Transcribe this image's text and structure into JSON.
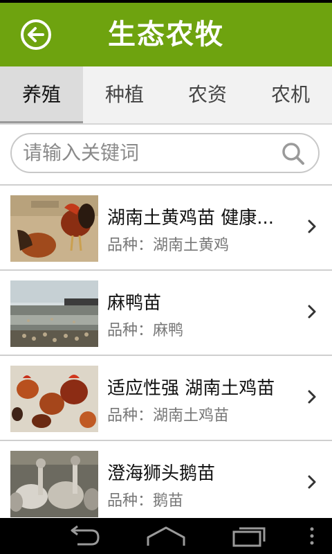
{
  "header": {
    "title": "生态农牧"
  },
  "tabs": [
    {
      "label": "养殖",
      "active": true
    },
    {
      "label": "种植",
      "active": false
    },
    {
      "label": "农资",
      "active": false
    },
    {
      "label": "农机",
      "active": false
    }
  ],
  "search": {
    "placeholder": "请输入关键词"
  },
  "items": [
    {
      "title": "湖南土黄鸡苗 健康...",
      "subtitle": "品种：湖南土黄鸡",
      "image": "chicken-yard-photo"
    },
    {
      "title": "麻鸭苗",
      "subtitle": "品种：麻鸭",
      "image": "duck-pond-photo"
    },
    {
      "title": "适应性强 湖南土鸡苗",
      "subtitle": "品种：湖南土鸡苗",
      "image": "chicken-flock-photo"
    },
    {
      "title": "澄海狮头鹅苗",
      "subtitle": "品种：鹅苗",
      "image": "goose-flock-photo"
    }
  ],
  "icons": {
    "back": "back-arrow-icon",
    "search": "search-icon",
    "chevron": "chevron-right-icon",
    "nav_back": "nav-back-icon",
    "nav_home": "nav-home-icon",
    "nav_recent": "nav-recent-apps-icon",
    "nav_menu": "nav-menu-icon"
  },
  "colors": {
    "appbar": "#6ea30f",
    "tab_bg": "#f2f2f2",
    "tab_active_bg": "#dcdcdc",
    "divider": "#cfcfcf"
  }
}
